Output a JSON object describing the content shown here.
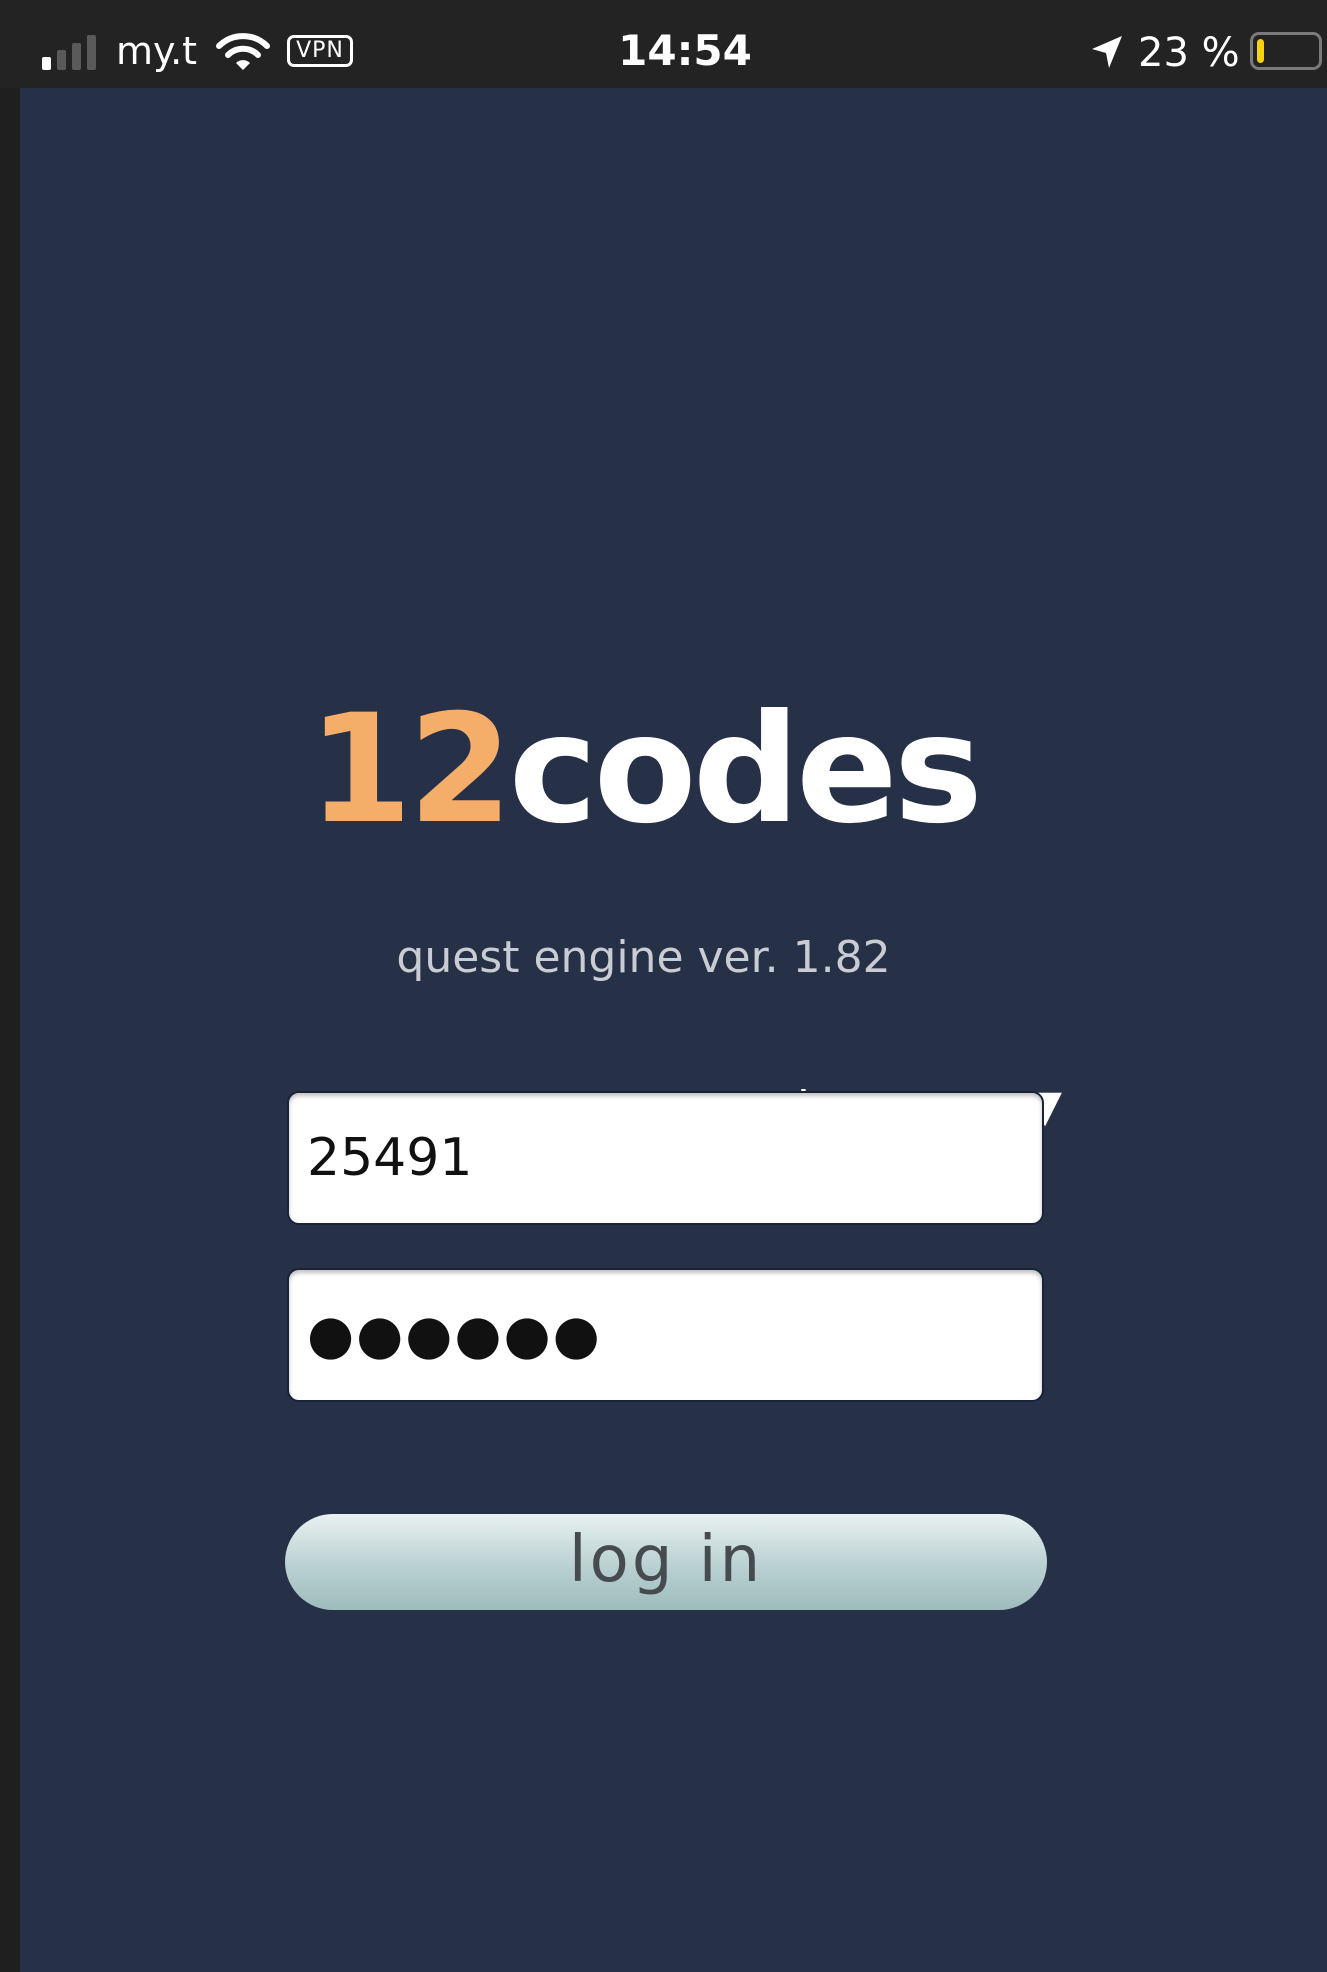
{
  "status_bar": {
    "carrier": "my.t",
    "vpn_label": "VPN",
    "time": "14:54",
    "battery_percent": "23 %",
    "battery_level": 0.23,
    "battery_color": "#f5d313"
  },
  "app": {
    "logo_number": "12",
    "logo_word": "codes",
    "version": "quest engine ver. 1.82",
    "language_label": "Language ▼",
    "username_value": "25491",
    "password_mask": "●●●●●●",
    "login_label": "log in",
    "colors": {
      "background": "#263047",
      "accent": "#f5ad6a"
    }
  }
}
